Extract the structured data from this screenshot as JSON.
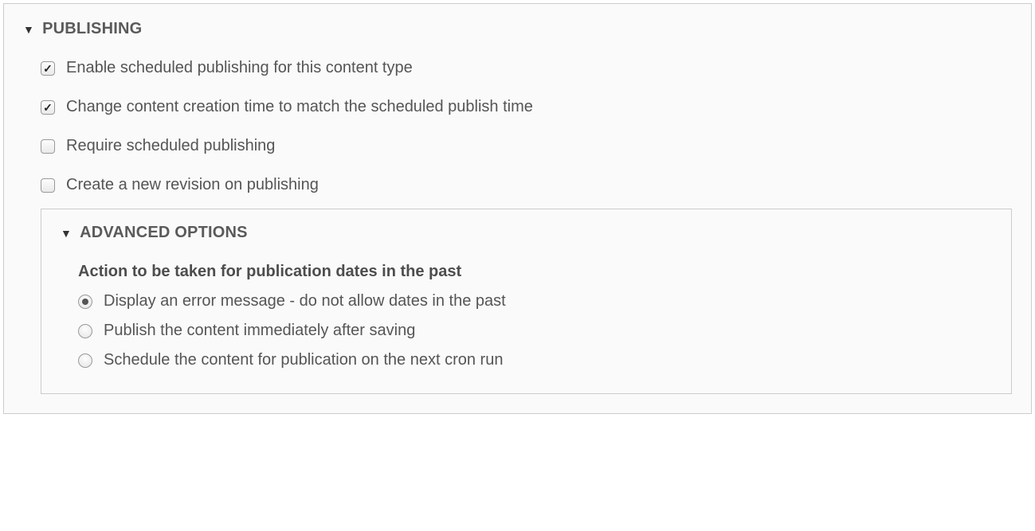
{
  "publishing": {
    "title": "Publishing",
    "options": [
      {
        "label": "Enable scheduled publishing for this content type",
        "checked": true
      },
      {
        "label": "Change content creation time to match the scheduled publish time",
        "checked": true
      },
      {
        "label": "Require scheduled publishing",
        "checked": false
      },
      {
        "label": "Create a new revision on publishing",
        "checked": false
      }
    ],
    "advanced": {
      "title": "Advanced options",
      "past_action": {
        "label": "Action to be taken for publication dates in the past",
        "options": [
          {
            "label": "Display an error message - do not allow dates in the past",
            "selected": true
          },
          {
            "label": "Publish the content immediately after saving",
            "selected": false
          },
          {
            "label": "Schedule the content for publication on the next cron run",
            "selected": false
          }
        ]
      }
    }
  }
}
